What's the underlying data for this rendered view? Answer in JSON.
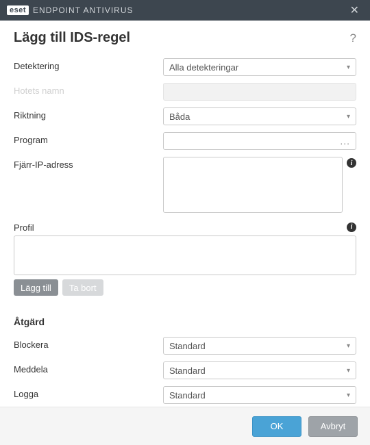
{
  "titlebar": {
    "brand_badge": "eset",
    "brand_text": "ENDPOINT ANTIVIRUS",
    "close_glyph": "✕"
  },
  "header": {
    "title": "Lägg till IDS-regel",
    "help_glyph": "?"
  },
  "fields": {
    "detection_label": "Detektering",
    "detection_value": "Alla detekteringar",
    "threat_name_label": "Hotets namn",
    "direction_label": "Riktning",
    "direction_value": "Båda",
    "program_label": "Program",
    "program_ellipsis": "...",
    "remote_ip_label": "Fjärr-IP-adress",
    "info_glyph": "i"
  },
  "profile": {
    "label": "Profil",
    "add_label": "Lägg till",
    "remove_label": "Ta bort"
  },
  "action": {
    "section_title": "Åtgärd",
    "block_label": "Blockera",
    "block_value": "Standard",
    "notify_label": "Meddela",
    "notify_value": "Standard",
    "log_label": "Logga",
    "log_value": "Standard"
  },
  "footer": {
    "ok_label": "OK",
    "cancel_label": "Avbryt"
  }
}
